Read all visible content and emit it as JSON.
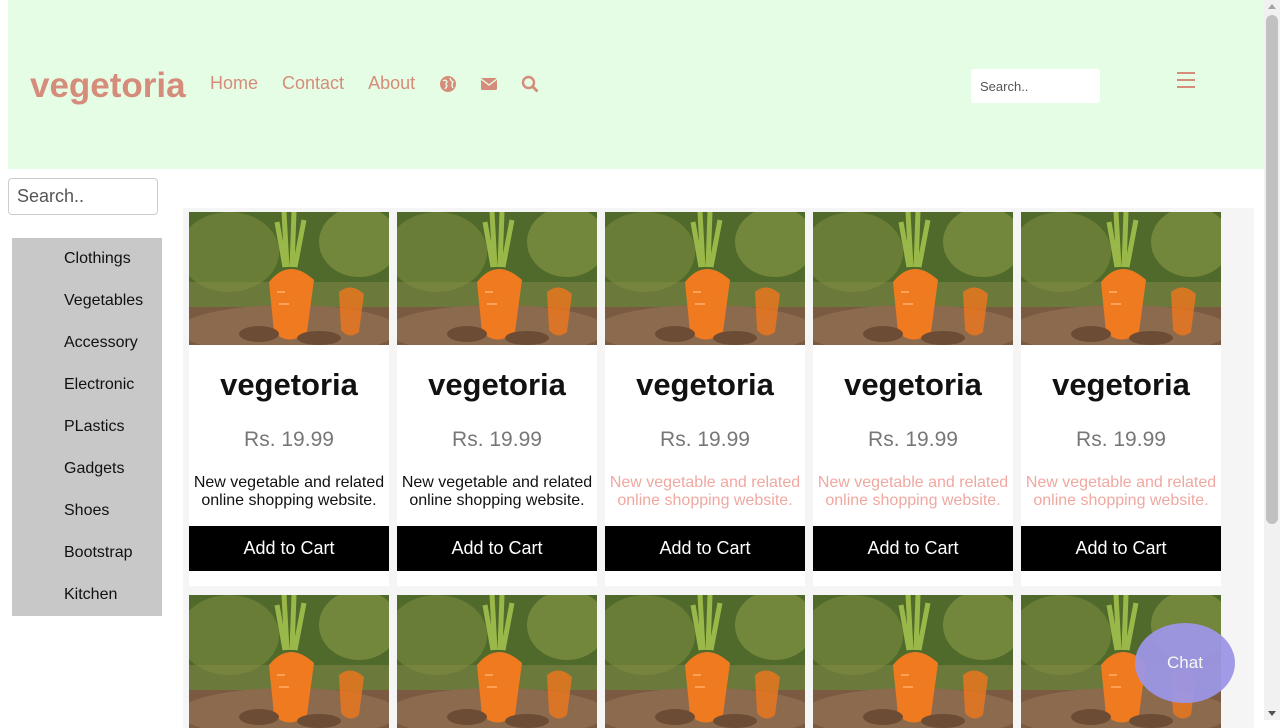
{
  "header": {
    "logo": "vegetoria",
    "nav": [
      {
        "label": "Home"
      },
      {
        "label": "Contact"
      },
      {
        "label": "About"
      }
    ],
    "nav_icons": [
      "globe-icon",
      "envelope-icon",
      "search-icon"
    ],
    "search_placeholder": "Search..",
    "menu_icon": "hamburger-menu-icon"
  },
  "sidebar": {
    "search_placeholder": "Search..",
    "items": [
      {
        "label": "Clothings"
      },
      {
        "label": "Vegetables"
      },
      {
        "label": "Accessory"
      },
      {
        "label": "Electronic"
      },
      {
        "label": "PLastics"
      },
      {
        "label": "Gadgets"
      },
      {
        "label": "Shoes"
      },
      {
        "label": "Bootstrap"
      },
      {
        "label": "Kitchen"
      }
    ]
  },
  "products": [
    {
      "name": "vegetoria",
      "price": "Rs. 19.99",
      "description": "New vegetable and related online shopping website.",
      "button": "Add to Cart"
    },
    {
      "name": "vegetoria",
      "price": "Rs. 19.99",
      "description": "New vegetable and related online shopping website.",
      "button": "Add to Cart"
    },
    {
      "name": "vegetoria",
      "price": "Rs. 19.99",
      "description": "New vegetable and related online shopping website.",
      "button": "Add to Cart"
    },
    {
      "name": "vegetoria",
      "price": "Rs. 19.99",
      "description": "New vegetable and related online shopping website.",
      "button": "Add to Cart"
    },
    {
      "name": "vegetoria",
      "price": "Rs. 19.99",
      "description": "New vegetable and related online shopping website.",
      "button": "Add to Cart"
    }
  ],
  "chat": {
    "label": "Chat"
  },
  "colors": {
    "header_bg": "#e5fde5",
    "accent": "#d68c7a",
    "sidebar_bg": "#c8c8c8",
    "button_bg": "#000000",
    "chat_bg": "#9d96e6"
  }
}
